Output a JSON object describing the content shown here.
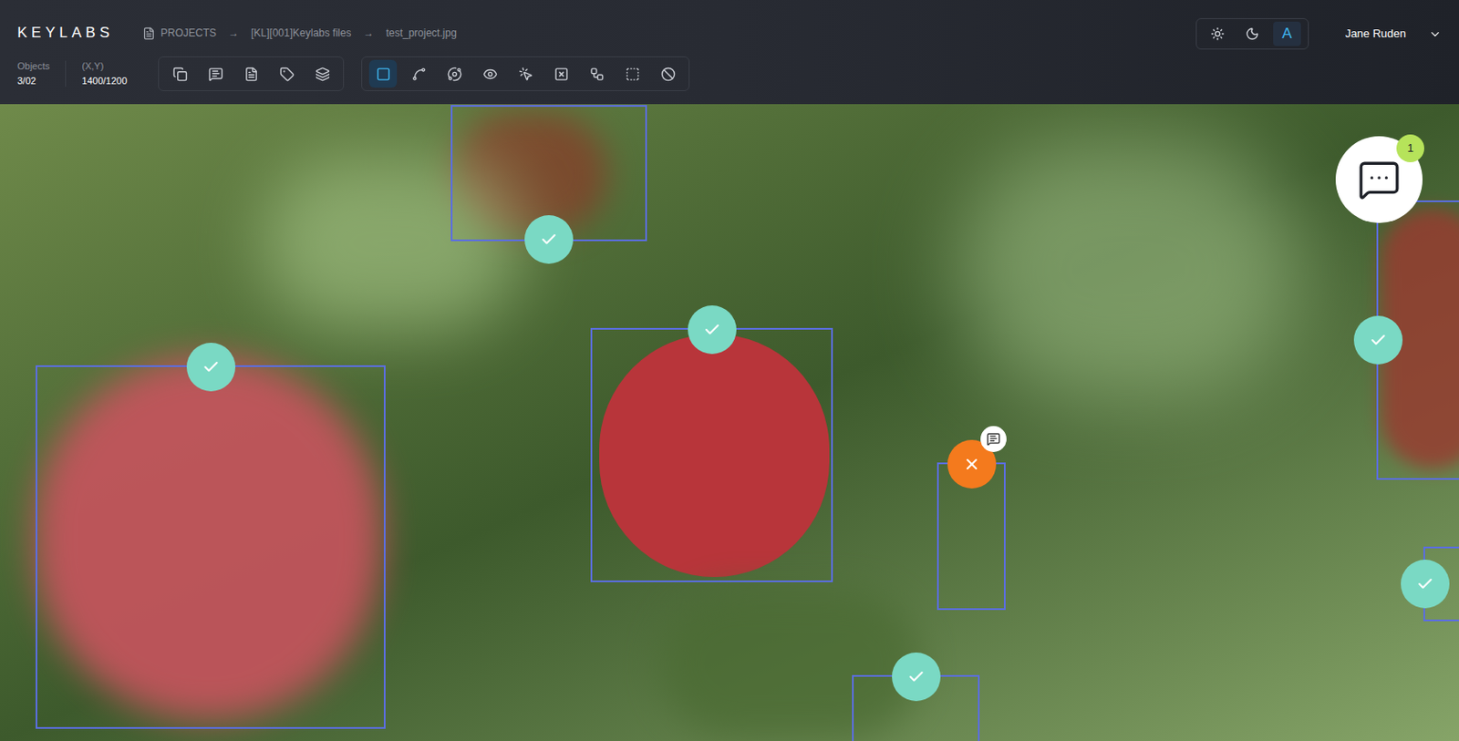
{
  "app": {
    "logo": "KEYLABS"
  },
  "breadcrumb": {
    "separator": "→",
    "items": [
      {
        "label": "PROJECTS"
      },
      {
        "label": "[KL][001]Keylabs files"
      },
      {
        "label": "test_project.jpg"
      }
    ]
  },
  "stats": [
    {
      "label": "Objects",
      "value": "3/02"
    },
    {
      "label": "(X,Y)",
      "value": "1400/1200"
    }
  ],
  "tool_groups": [
    [
      {
        "selected": false
      },
      {
        "selected": false
      },
      {
        "selected": false
      },
      {
        "selected": false
      },
      {
        "selected": false
      }
    ],
    [
      {
        "selected": true
      },
      {
        "selected": false
      },
      {
        "selected": false
      },
      {
        "selected": false
      },
      {
        "selected": false
      },
      {
        "selected": false
      },
      {
        "selected": false
      },
      {
        "selected": false
      },
      {
        "selected": false
      }
    ]
  ],
  "theme": [
    {
      "kind": "light",
      "selected": false
    },
    {
      "kind": "dark",
      "selected": false
    },
    {
      "kind": "auto",
      "label": "A",
      "selected": true
    }
  ],
  "user": {
    "name": "Jane Ruden"
  },
  "chat": {
    "count": "1"
  },
  "annotations": [
    {
      "approved": true,
      "comment": false
    },
    {
      "approved": true,
      "comment": false
    },
    {
      "approved": true,
      "comment": false
    },
    {
      "approved": true,
      "comment": false
    },
    {
      "approved": true,
      "comment": false
    },
    {
      "approved": true,
      "comment": false
    },
    {
      "approved": false,
      "comment": true
    }
  ]
}
